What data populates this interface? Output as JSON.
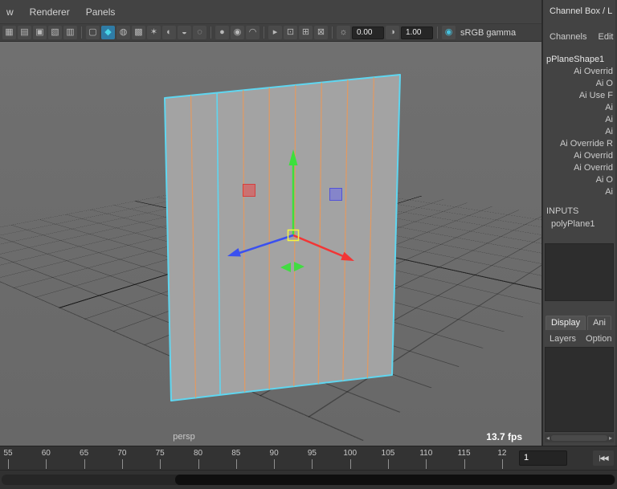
{
  "menubar": {
    "items": [
      "w",
      "Renderer",
      "Panels"
    ]
  },
  "toolbar": {
    "items": [
      {
        "type": "icon",
        "name": "select-camera-icon",
        "glyph": "▦"
      },
      {
        "type": "icon",
        "name": "grid-display-icon",
        "glyph": "▤"
      },
      {
        "type": "icon",
        "name": "film-gate-icon",
        "glyph": "▣"
      },
      {
        "type": "icon",
        "name": "resolution-gate-icon",
        "glyph": "▧"
      },
      {
        "type": "icon",
        "name": "gate-mask-icon",
        "glyph": "▥"
      },
      {
        "type": "sep"
      },
      {
        "type": "icon",
        "name": "wireframe-display-icon",
        "glyph": "▢"
      },
      {
        "type": "icon",
        "name": "shaded-display-icon",
        "glyph": "◆",
        "active": true,
        "color": "#49d6e8"
      },
      {
        "type": "icon",
        "name": "textured-display-icon",
        "glyph": "◍"
      },
      {
        "type": "icon",
        "name": "checker-map-icon",
        "glyph": "▩"
      },
      {
        "type": "icon",
        "name": "use-all-lights-icon",
        "glyph": "✶"
      },
      {
        "type": "icon",
        "name": "shadows-icon",
        "glyph": "◐"
      },
      {
        "type": "icon",
        "name": "ambient-occlusion-icon",
        "glyph": "◒"
      },
      {
        "type": "icon",
        "name": "motion-blur-icon",
        "glyph": "◌"
      },
      {
        "type": "sep"
      },
      {
        "type": "icon",
        "name": "multisample-icon",
        "glyph": "●"
      },
      {
        "type": "icon",
        "name": "depth-of-field-icon",
        "glyph": "◉"
      },
      {
        "type": "icon",
        "name": "curve-smoothness-icon",
        "glyph": "◠"
      },
      {
        "type": "sep"
      },
      {
        "type": "icon",
        "name": "select-object-icon",
        "glyph": "▸"
      },
      {
        "type": "icon",
        "name": "isolate-select-icon",
        "glyph": "⊡"
      },
      {
        "type": "icon",
        "name": "pane-layout-icon",
        "glyph": "⊞"
      },
      {
        "type": "icon",
        "name": "xray-display-icon",
        "glyph": "⊠"
      },
      {
        "type": "sep"
      },
      {
        "type": "icon",
        "name": "exposure-icon",
        "glyph": "☼"
      },
      {
        "type": "field",
        "name": "exposure-field",
        "value": "0.00"
      },
      {
        "type": "icon",
        "name": "gamma-icon",
        "glyph": "◑"
      },
      {
        "type": "field",
        "name": "gamma-field",
        "value": "1.00"
      },
      {
        "type": "sep"
      },
      {
        "type": "icon",
        "name": "view-transform-icon",
        "glyph": "◉",
        "color": "#45c0dc"
      },
      {
        "type": "label",
        "name": "colorspace-label",
        "value": "sRGB gamma"
      }
    ]
  },
  "viewport": {
    "camera_label": "persp",
    "fps_label": "13.7 fps",
    "selection_color": "#5fd6f0",
    "wire_color": "#e8995c",
    "manipulator_colors": {
      "x": "#f23535",
      "y": "#3ce03c",
      "z": "#3a50f0",
      "center": "#f7f73f"
    }
  },
  "channel_box": {
    "title": "Channel Box / L",
    "menus": [
      "Channels",
      "Edit"
    ],
    "shape_node": "pPlaneShape1",
    "attributes": [
      "Ai Overrid",
      "Ai O",
      "Ai Use F",
      "Ai",
      "Ai",
      "Ai",
      "Ai Override R",
      "Ai Overrid",
      "Ai Overrid",
      "Ai O",
      "Ai"
    ],
    "inputs_label": "INPUTS",
    "input_node": "polyPlane1",
    "tabs": [
      {
        "label": "Display",
        "active": true
      },
      {
        "label": "Ani",
        "active": false
      }
    ],
    "layer_menus": [
      "Layers",
      "Option"
    ],
    "scroll_left_arrow": "◂",
    "scroll_right_arrow": "▸"
  },
  "timeline": {
    "tick_labels": [
      "55",
      "60",
      "65",
      "70",
      "75",
      "80",
      "85",
      "90",
      "95",
      "100",
      "105",
      "110",
      "115",
      "12"
    ],
    "current_frame": "1",
    "go_to_start_label": "|◀◀"
  }
}
